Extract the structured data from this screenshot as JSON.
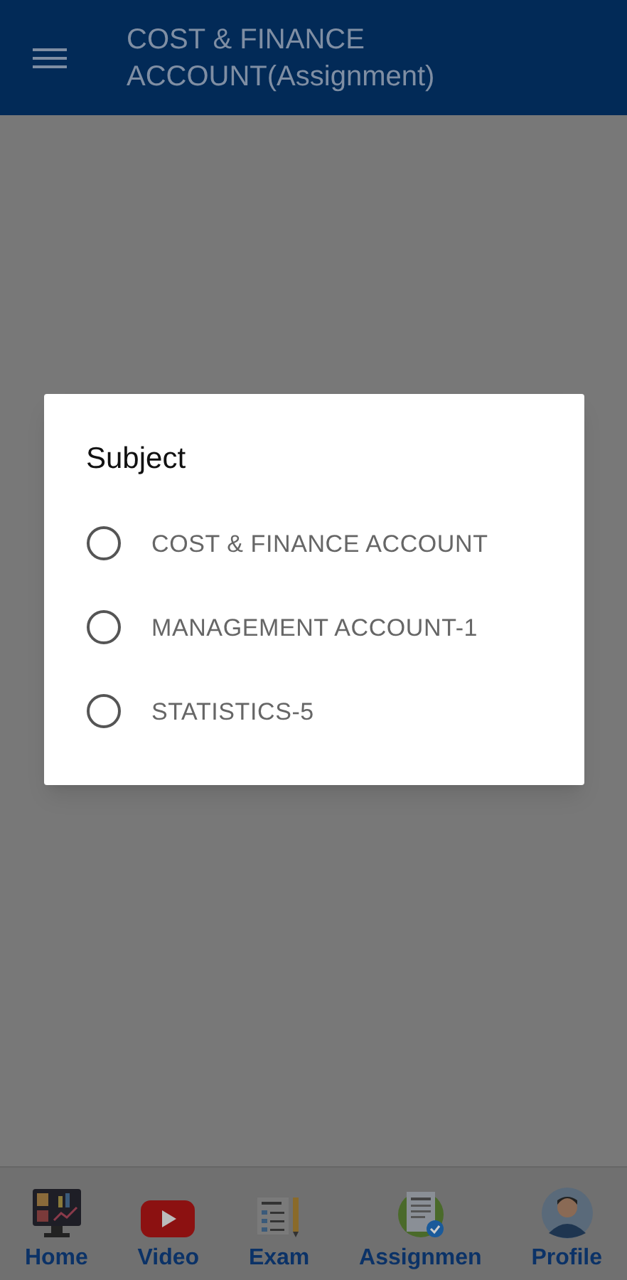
{
  "app_bar": {
    "title": "COST & FINANCE ACCOUNT(Assignment)"
  },
  "dialog": {
    "title": "Subject",
    "options": [
      {
        "label": "COST & FINANCE ACCOUNT",
        "selected": false
      },
      {
        "label": "MANAGEMENT ACCOUNT-1",
        "selected": false
      },
      {
        "label": "STATISTICS-5",
        "selected": false
      }
    ]
  },
  "bottom_nav": [
    {
      "label": "Home",
      "kind": "monitor"
    },
    {
      "label": "Video",
      "kind": "play"
    },
    {
      "label": "Exam",
      "kind": "list"
    },
    {
      "label": "Assignmen",
      "kind": "document"
    },
    {
      "label": "Profile",
      "kind": "person"
    }
  ]
}
